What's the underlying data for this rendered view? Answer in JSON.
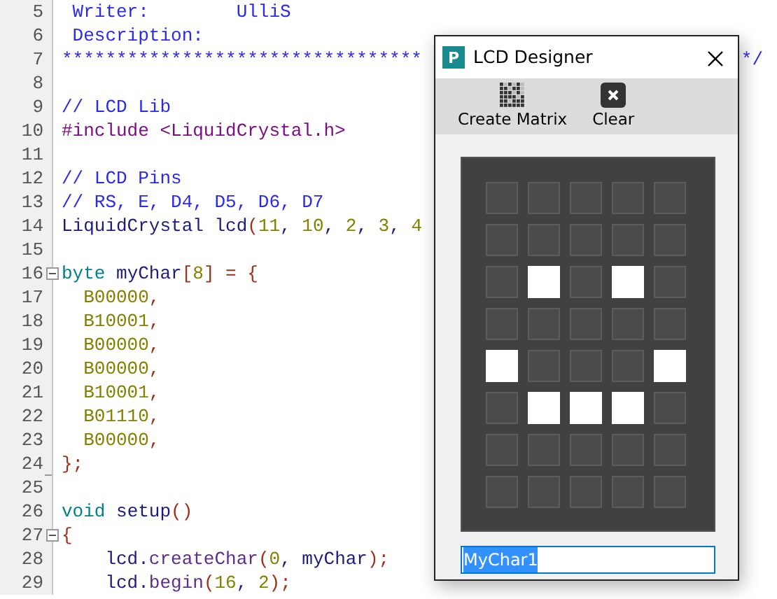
{
  "editor": {
    "lines": [
      {
        "number": "5",
        "segments": [
          {
            "text": " Writer:        UlliS",
            "kind": "comment"
          }
        ]
      },
      {
        "number": "6",
        "segments": [
          {
            "text": " Description:",
            "kind": "comment"
          }
        ]
      },
      {
        "number": "7",
        "segments": [
          {
            "text": "*********************************",
            "kind": "comment"
          }
        ],
        "tail": "*/"
      },
      {
        "number": "8"
      },
      {
        "number": "9",
        "segments": [
          {
            "text": "// LCD Lib",
            "kind": "comment"
          }
        ]
      },
      {
        "number": "10",
        "segments": [
          {
            "text": "#include <LiquidCrystal.h>",
            "kind": "preproc"
          }
        ]
      },
      {
        "number": "11"
      },
      {
        "number": "12",
        "segments": [
          {
            "text": "// LCD Pins",
            "kind": "comment"
          }
        ]
      },
      {
        "number": "13",
        "segments": [
          {
            "text": "// RS, E, D4, D5, D6, D7",
            "kind": "comment"
          }
        ]
      },
      {
        "number": "14",
        "segments": [
          {
            "text": "LiquidCrystal lcd",
            "kind": "ident"
          },
          {
            "text": "(",
            "kind": "punct"
          },
          {
            "text": "11",
            "kind": "number"
          },
          {
            "text": ", ",
            "kind": "ident"
          },
          {
            "text": "10",
            "kind": "number"
          },
          {
            "text": ", ",
            "kind": "ident"
          },
          {
            "text": "2",
            "kind": "number"
          },
          {
            "text": ", ",
            "kind": "ident"
          },
          {
            "text": "3",
            "kind": "number"
          },
          {
            "text": ", ",
            "kind": "ident"
          },
          {
            "text": "4",
            "kind": "number"
          }
        ]
      },
      {
        "number": "15"
      },
      {
        "number": "16",
        "fold_toggle": true,
        "segments": [
          {
            "text": "byte",
            "kind": "keyword"
          },
          {
            "text": " myChar",
            "kind": "ident"
          },
          {
            "text": "[",
            "kind": "punct"
          },
          {
            "text": "8",
            "kind": "number"
          },
          {
            "text": "] = {",
            "kind": "punct"
          }
        ]
      },
      {
        "number": "17",
        "segments": [
          {
            "text": "  B00000",
            "kind": "number"
          },
          {
            "text": ",",
            "kind": "punct"
          }
        ]
      },
      {
        "number": "18",
        "segments": [
          {
            "text": "  B10001",
            "kind": "number"
          },
          {
            "text": ",",
            "kind": "punct"
          }
        ]
      },
      {
        "number": "19",
        "segments": [
          {
            "text": "  B00000",
            "kind": "number"
          },
          {
            "text": ",",
            "kind": "punct"
          }
        ]
      },
      {
        "number": "20",
        "segments": [
          {
            "text": "  B00000",
            "kind": "number"
          },
          {
            "text": ",",
            "kind": "punct"
          }
        ]
      },
      {
        "number": "21",
        "segments": [
          {
            "text": "  B10001",
            "kind": "number"
          },
          {
            "text": ",",
            "kind": "punct"
          }
        ]
      },
      {
        "number": "22",
        "segments": [
          {
            "text": "  B01110",
            "kind": "number"
          },
          {
            "text": ",",
            "kind": "punct"
          }
        ]
      },
      {
        "number": "23",
        "segments": [
          {
            "text": "  B00000",
            "kind": "number"
          },
          {
            "text": ",",
            "kind": "punct"
          }
        ]
      },
      {
        "number": "24",
        "fold_end": true,
        "segments": [
          {
            "text": "};",
            "kind": "punct"
          }
        ]
      },
      {
        "number": "25"
      },
      {
        "number": "26",
        "segments": [
          {
            "text": "void",
            "kind": "keyword"
          },
          {
            "text": " setup",
            "kind": "ident"
          },
          {
            "text": "()",
            "kind": "punct"
          }
        ]
      },
      {
        "number": "27",
        "fold_toggle": true,
        "segments": [
          {
            "text": "{",
            "kind": "punct"
          }
        ]
      },
      {
        "number": "28",
        "segments": [
          {
            "text": "    lcd.",
            "kind": "ident"
          },
          {
            "text": "createChar",
            "kind": "method"
          },
          {
            "text": "(",
            "kind": "punct"
          },
          {
            "text": "0",
            "kind": "number"
          },
          {
            "text": ", myChar",
            "kind": "ident"
          },
          {
            "text": ");",
            "kind": "punct"
          }
        ]
      },
      {
        "number": "29",
        "segments": [
          {
            "text": "    lcd.",
            "kind": "ident"
          },
          {
            "text": "begin",
            "kind": "method"
          },
          {
            "text": "(",
            "kind": "punct"
          },
          {
            "text": "16",
            "kind": "number"
          },
          {
            "text": ", ",
            "kind": "ident"
          },
          {
            "text": "2",
            "kind": "number"
          },
          {
            "text": ");",
            "kind": "punct"
          }
        ]
      }
    ]
  },
  "dialog": {
    "title": "LCD Designer",
    "app_icon": "P",
    "toolbar": [
      {
        "label": "Create Matrix",
        "kind": "matrix"
      },
      {
        "label": "Clear",
        "kind": "clear"
      }
    ],
    "matrix": {
      "rows": [
        [
          false,
          false,
          false,
          false,
          false
        ],
        [
          false,
          false,
          false,
          false,
          false
        ],
        [
          false,
          true,
          false,
          true,
          false
        ],
        [
          false,
          false,
          false,
          false,
          false
        ],
        [
          true,
          false,
          false,
          false,
          true
        ],
        [
          false,
          true,
          true,
          true,
          false
        ],
        [
          false,
          false,
          false,
          false,
          false
        ],
        [
          false,
          false,
          false,
          false,
          false
        ]
      ]
    },
    "name_field": {
      "value": "MyChar1",
      "selected": true
    }
  }
}
